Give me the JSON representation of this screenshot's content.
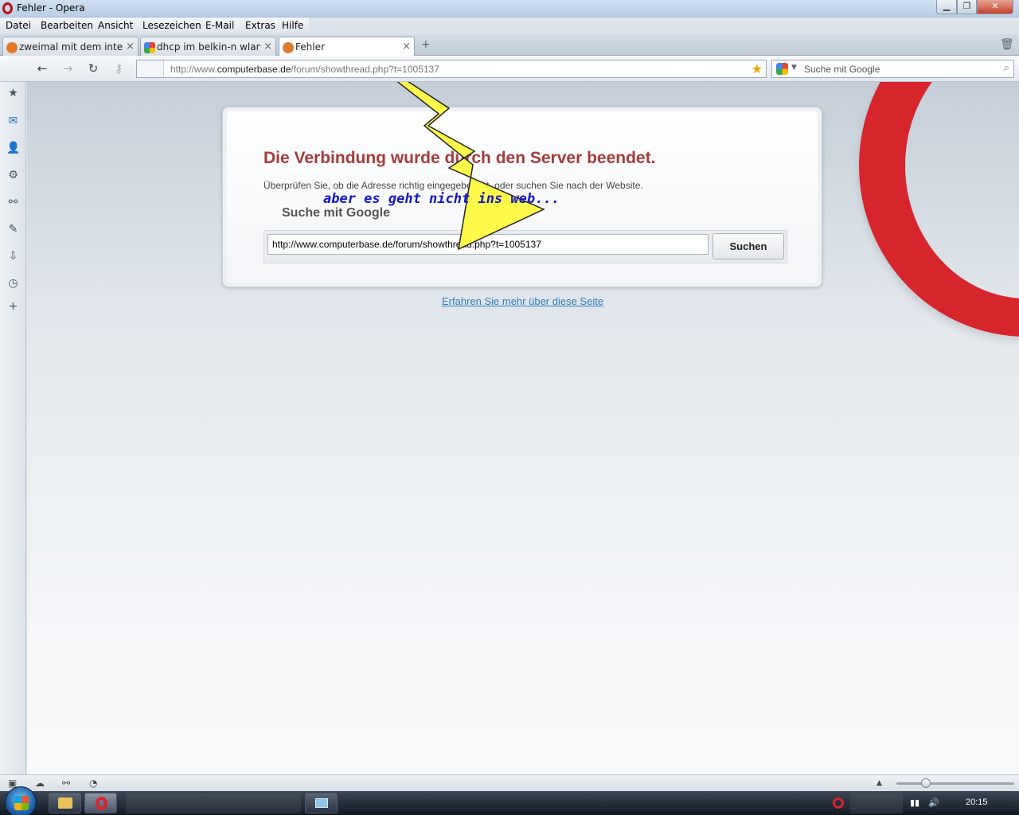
{
  "window": {
    "title": "Fehler - Opera",
    "min_glyph": "▁",
    "max_glyph": "❐",
    "close_glyph": "✕"
  },
  "menu": {
    "items": [
      "Datei",
      "Bearbeiten",
      "Ansicht",
      "Lesezeichen",
      "E-Mail",
      "Extras",
      "Hilfe"
    ]
  },
  "tabs": [
    {
      "label": "zweimal mit dem inter...",
      "close": "×"
    },
    {
      "label": "dhcp im belkin-n wlan ...",
      "close": "×"
    },
    {
      "label": "Fehler",
      "close": "×"
    }
  ],
  "tabbar_tools": {
    "new_tab_glyph": "+",
    "trash_glyph": "🗑"
  },
  "nav": {
    "back": "←",
    "forward": "→",
    "reload": "↻",
    "key": "⚷"
  },
  "address": {
    "prefix": "http://www.",
    "host": "computerbase.de",
    "path": "/forum/showthread.php?t=1005137",
    "star": "★"
  },
  "search": {
    "placeholder": "Suche mit Google",
    "drop": "▼",
    "mag": "⌕"
  },
  "sidebar_icons": [
    "bookmarks-icon",
    "mail-icon",
    "contacts-icon",
    "widgets-icon",
    "unite-icon",
    "notes-icon",
    "transfers-icon",
    "history-icon",
    "add-panel-icon"
  ],
  "sidebar_glyphs": [
    "★",
    "✉",
    "👤",
    "⚙",
    "⚯",
    "✎",
    "⇩",
    "◷",
    "+"
  ],
  "error_page": {
    "title": "Die Verbindung wurde durch den Server beendet.",
    "description": "Überprüfen Sie, ob die Adresse richtig eingegeben ist, oder suchen Sie nach der Website.",
    "search_label": "Suche mit Google",
    "search_value": "http://www.computerbase.de/forum/showthread.php?t=1005137",
    "search_button": "Suchen",
    "learn_more": "Erfahren Sie mehr über diese Seite"
  },
  "annotation": {
    "text": "aber es geht nicht ins web...",
    "color": "#1515c8"
  },
  "statusbar": {
    "icons": [
      "panel-toggle-icon",
      "cloud-icon",
      "unite-icon",
      "turbo-icon"
    ],
    "glyphs": [
      "▣",
      "☁",
      "⚯",
      "◔"
    ],
    "zoom_up": "▲",
    "zoom_level": 0.25
  },
  "taskbar": {
    "clock": "20:15",
    "tray_glyphs": [
      "◙",
      "▮▮",
      "🔊"
    ]
  },
  "colors": {
    "error_title": "#a53b3b",
    "link": "#2f7fc1",
    "opera_red": "#d6252c",
    "bolt_fill": "#fff94a"
  }
}
